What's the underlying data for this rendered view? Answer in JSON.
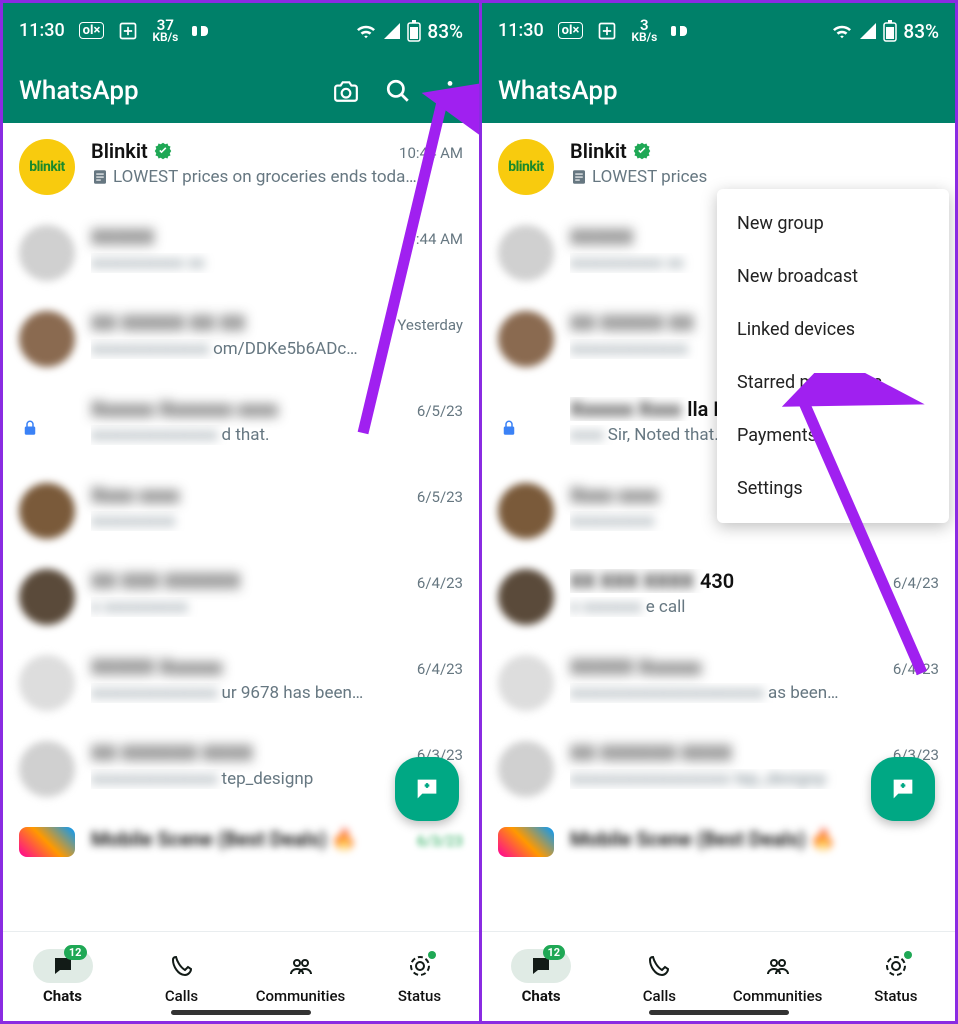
{
  "statusbar": {
    "time": "11:30",
    "data_rate_left": "37",
    "data_rate_right": "3",
    "data_rate_unit": "KB/s",
    "battery_text": "83%"
  },
  "appbar": {
    "title": "WhatsApp"
  },
  "blinkit": {
    "name": "Blinkit",
    "preview_left": "LOWEST prices on groceries ends toda…",
    "preview_right": "LOWEST prices",
    "time_left": "10:44 AM",
    "avatar_label": "blinkit"
  },
  "rows": [
    {
      "time": "9:44 AM",
      "preview_visible": ""
    },
    {
      "time": "Yesterday",
      "preview_visible": "om/DDKe5b6ADc…"
    },
    {
      "time": "6/5/23",
      "preview_visible": "d that.",
      "name_visible_right": "lla New",
      "preview_right": "Sir,   Noted that."
    },
    {
      "time": "6/5/23",
      "preview_visible": ""
    },
    {
      "time": "6/4/23",
      "preview_visible": "",
      "name_visible_right": "430",
      "preview_right": "e call"
    },
    {
      "time": "6/4/23",
      "preview_visible": "ur 9678 has been…",
      "preview_right": "as been…"
    },
    {
      "time": "6/3/23",
      "preview_visible": "tep_designp"
    },
    {
      "time": "",
      "name_visible": "Mobile Scene (Best Deals)"
    }
  ],
  "menu": {
    "items": [
      "New group",
      "New broadcast",
      "Linked devices",
      "Starred messages",
      "Payments",
      "Settings"
    ]
  },
  "bottomnav": {
    "chats": {
      "label": "Chats",
      "badge": "12"
    },
    "calls": {
      "label": "Calls"
    },
    "communities": {
      "label": "Communities"
    },
    "status": {
      "label": "Status"
    }
  }
}
